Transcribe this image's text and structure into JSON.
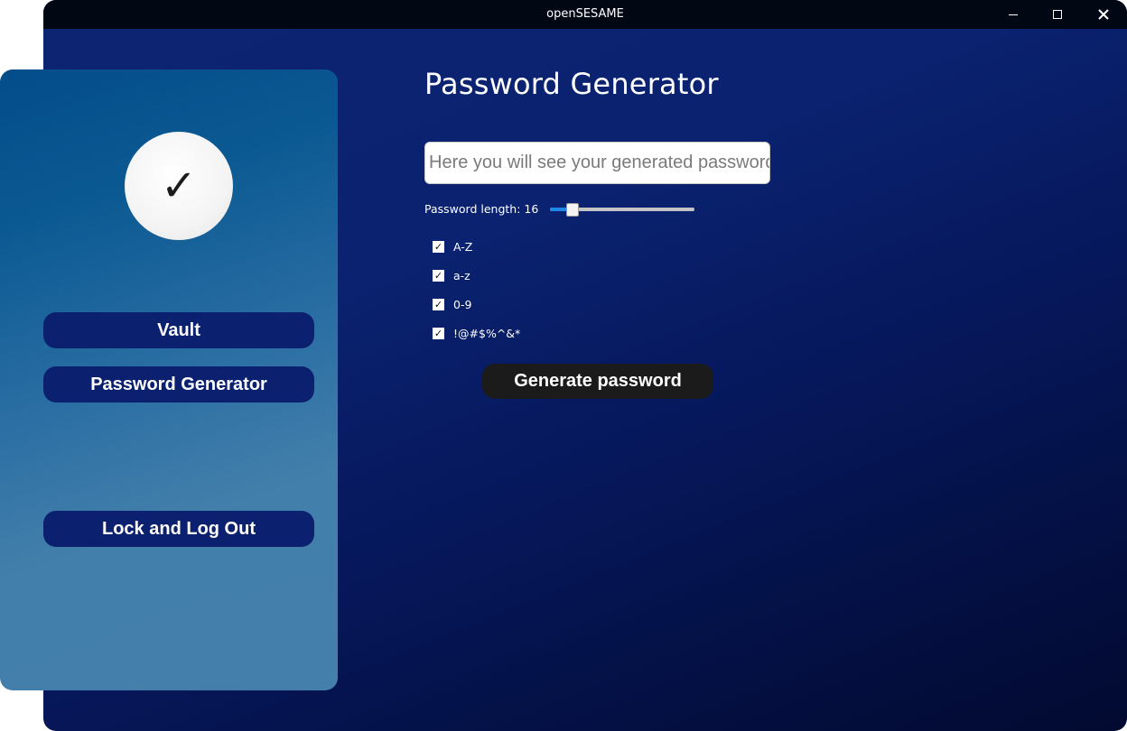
{
  "window": {
    "title": "openSESAME",
    "controls": {
      "minimize_icon": "minimize-icon",
      "maximize_icon": "maximize-icon",
      "close_icon": "close-icon"
    }
  },
  "sidebar": {
    "avatar_glyph": "✓",
    "nav": {
      "vault": "Vault",
      "password_generator": "Password Generator",
      "lock_logout": "Lock and Log Out"
    }
  },
  "main": {
    "title": "Password Generator",
    "password_field": {
      "value": "",
      "placeholder": "Here you will see your generated password"
    },
    "length": {
      "label": "Password length: 16",
      "value": 16,
      "slider_fraction": 0.15
    },
    "options": [
      {
        "label": "A-Z",
        "checked": true,
        "mark": "✓"
      },
      {
        "label": "a-z",
        "checked": true,
        "mark": "✓"
      },
      {
        "label": "0-9",
        "checked": true,
        "mark": "✓"
      },
      {
        "label": "!@#$%^&*",
        "checked": true,
        "mark": "✓"
      }
    ],
    "generate_button": "Generate password"
  },
  "colors": {
    "titlebar": "#010814",
    "background_top": "#0c2472",
    "background_bottom": "#020a30",
    "sidebar_top": "#034d8a",
    "sidebar_bottom": "#447fab",
    "nav_button": "#0b2170",
    "generate_button": "#1b1b1b",
    "slider_accent": "#1e88e5"
  }
}
